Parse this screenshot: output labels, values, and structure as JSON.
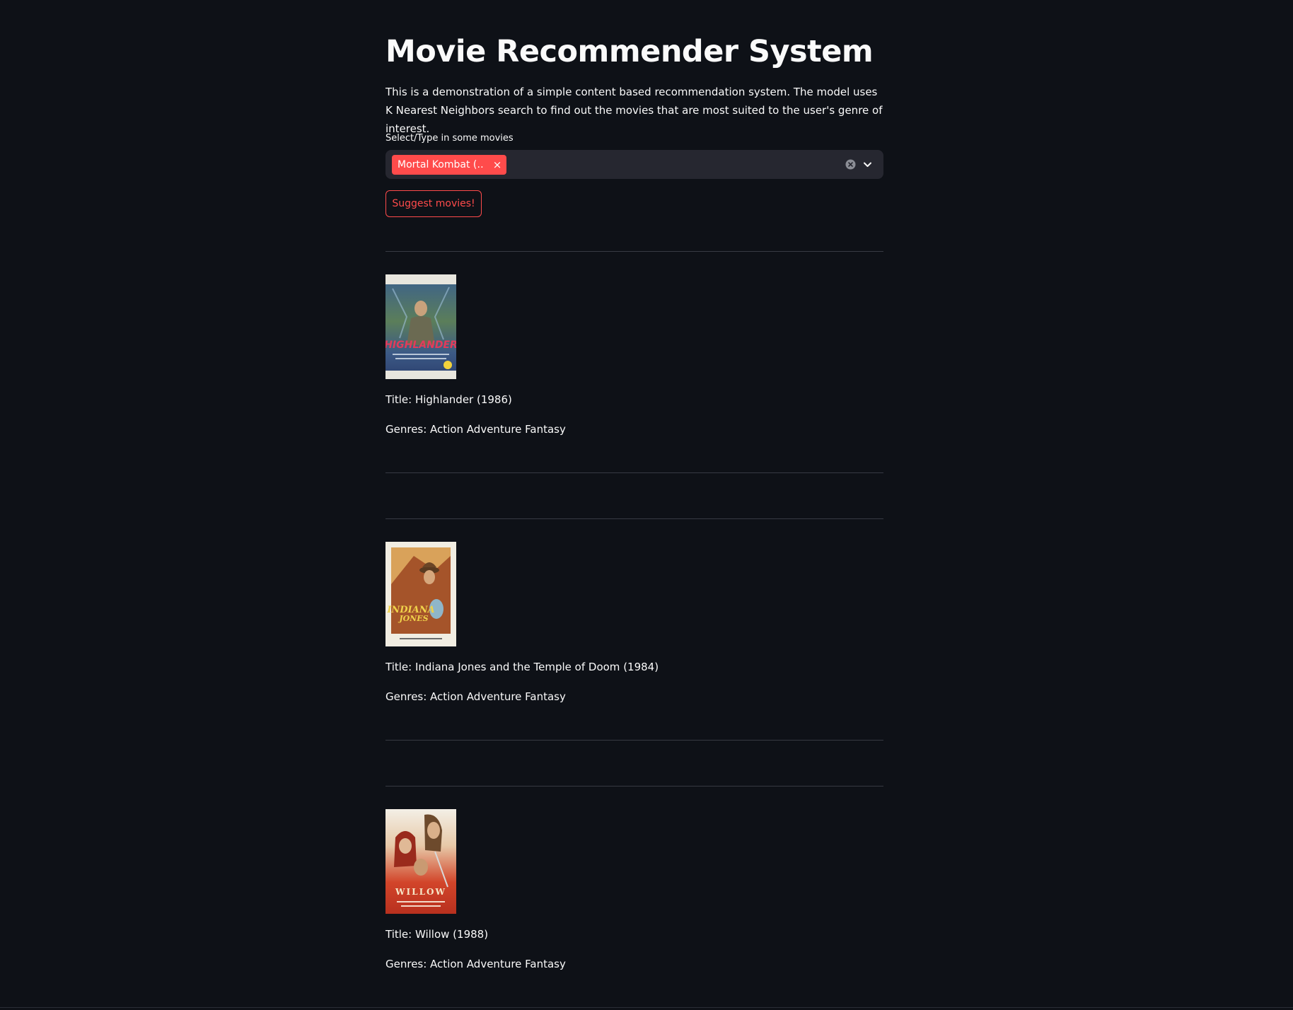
{
  "app": {
    "title": "Movie Recommender System",
    "description": "This is a demonstration of a simple content based recommendation system. The model uses K Nearest Neighbors search to find out the movies that are most suited to the user's genre of interest."
  },
  "select": {
    "label": "Select/Type in some movies",
    "selected_tag": "Mortal Kombat (…",
    "remove_glyph": "×"
  },
  "suggest_button": {
    "label": "Suggest movies!"
  },
  "movies": [
    {
      "poster_icon": "highlander-poster",
      "title": "Title: Highlander (1986)",
      "genres": "Genres: Action Adventure Fantasy"
    },
    {
      "poster_icon": "indiana-jones-poster",
      "title": "Title: Indiana Jones and the Temple of Doom (1984)",
      "genres": "Genres: Action Adventure Fantasy"
    },
    {
      "poster_icon": "willow-poster",
      "title": "Title: Willow (1988)",
      "genres": "Genres: Action Adventure Fantasy"
    }
  ],
  "colors": {
    "background": "#0e1117",
    "accent": "#ff4b4b",
    "input_background": "#262730",
    "text": "#fafafa",
    "divider": "#373a43"
  }
}
